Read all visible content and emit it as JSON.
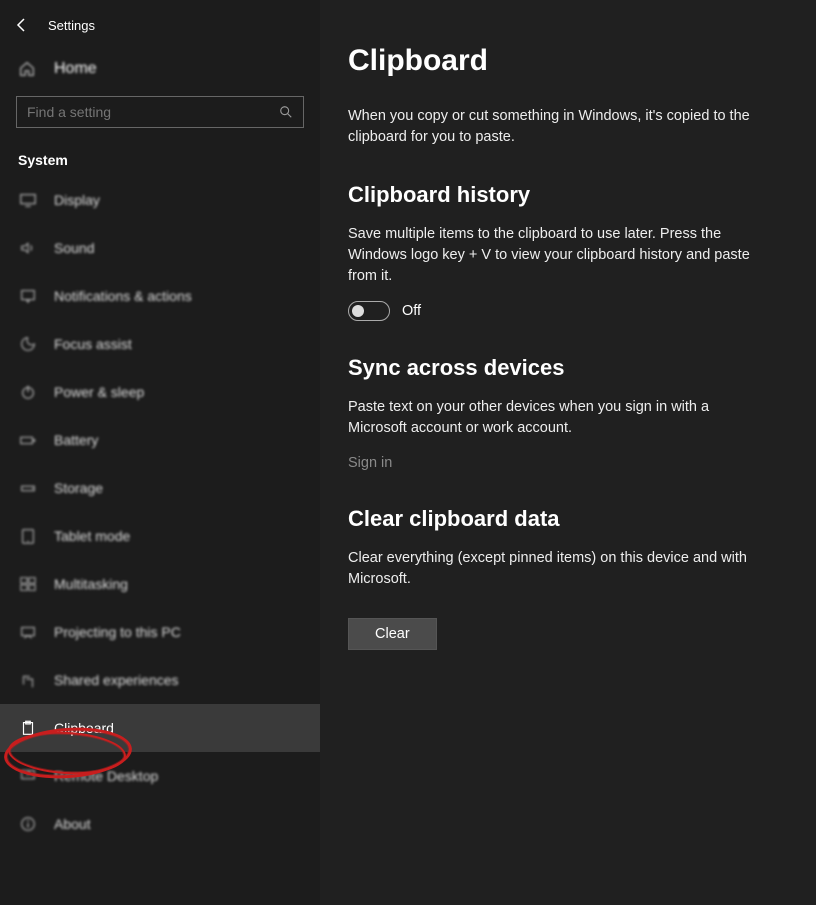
{
  "app": {
    "title": "Settings"
  },
  "sidebar": {
    "home_label": "Home",
    "search_placeholder": "Find a setting",
    "section_label": "System",
    "items": [
      {
        "label": "Display"
      },
      {
        "label": "Sound"
      },
      {
        "label": "Notifications & actions"
      },
      {
        "label": "Focus assist"
      },
      {
        "label": "Power & sleep"
      },
      {
        "label": "Battery"
      },
      {
        "label": "Storage"
      },
      {
        "label": "Tablet mode"
      },
      {
        "label": "Multitasking"
      },
      {
        "label": "Projecting to this PC"
      },
      {
        "label": "Shared experiences"
      },
      {
        "label": "Clipboard"
      },
      {
        "label": "Remote Desktop"
      },
      {
        "label": "About"
      }
    ],
    "selected_index": 11
  },
  "main": {
    "title": "Clipboard",
    "intro": "When you copy or cut something in Windows, it's copied to the clipboard for you to paste.",
    "history": {
      "heading": "Clipboard history",
      "text": "Save multiple items to the clipboard to use later. Press the Windows logo key + V to view your clipboard history and paste from it.",
      "toggle_state": "Off"
    },
    "sync": {
      "heading": "Sync across devices",
      "text": "Paste text on your other devices when you sign in with a Microsoft account or work account.",
      "signin_label": "Sign in"
    },
    "clear": {
      "heading": "Clear clipboard data",
      "text": "Clear everything (except pinned items) on this device and with Microsoft.",
      "button_label": "Clear"
    }
  },
  "annotation": {
    "circled_item_index": 11
  }
}
